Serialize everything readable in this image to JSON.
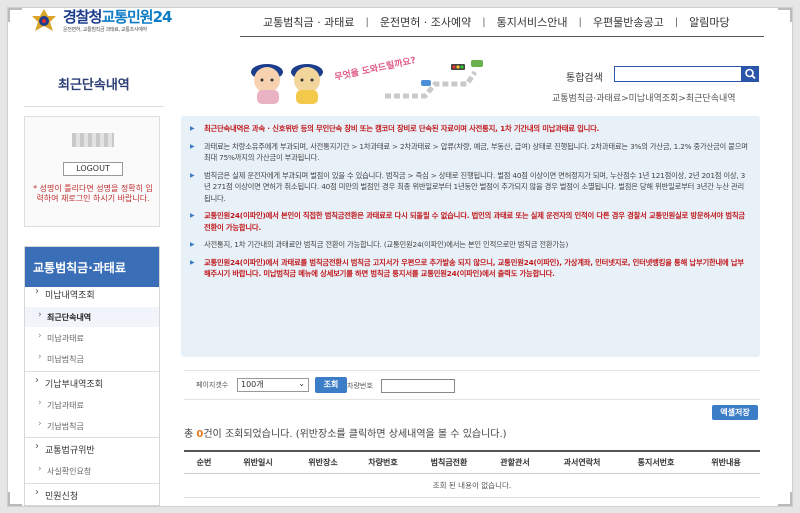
{
  "header": {
    "logo_police": "경찰청",
    "logo_service": "교통민원24",
    "logo_sub": "운전면허, 교통범칙금 과태료, 교통조사예약",
    "nav": [
      "교통범칙금 · 과태료",
      "운전면허 · 조사예약",
      "통지서비스안내",
      "우편물반송공고",
      "알림마당"
    ]
  },
  "page": {
    "title": "최근단속내역",
    "illustration_text": "무엇을 도와드릴까요?",
    "search_label": "통합검색",
    "search_placeholder": "",
    "breadcrumb": "교통범칙금·과태료>미납내역조회>최근단속내역"
  },
  "login": {
    "logout_label": "LOGOUT",
    "note": "* 성명이 틀리다면 성명을 정확히 입력하여 재로그인 하시기 바랍니다."
  },
  "sidebar": {
    "header": "교통범칙금·과태료",
    "items": [
      {
        "label": "미납내역조회",
        "type": "section"
      },
      {
        "label": "최근단속내역",
        "type": "sub",
        "active": true
      },
      {
        "label": "미납과태료",
        "type": "sub"
      },
      {
        "label": "미납범칙금",
        "type": "sub"
      },
      {
        "label": "기납부내역조회",
        "type": "section"
      },
      {
        "label": "기납과태료",
        "type": "sub"
      },
      {
        "label": "기납범칙금",
        "type": "sub"
      },
      {
        "label": "교통법규위반",
        "type": "section"
      },
      {
        "label": "사실확인요청",
        "type": "sub"
      },
      {
        "label": "민원신청",
        "type": "section"
      }
    ]
  },
  "info": [
    {
      "text": "최근단속내역은 과속 · 신호위반 등의 무인단속 장비 또는 캠코더 장비로 단속된 자료이며 사전통지, 1차 기간내의 미납과태료 입니다.",
      "red": true
    },
    {
      "text": "과태료는 차량소유주에게 부과되며, 사전통지기간 > 1차과태료 > 2차과태료 > 압류(차량, 예금, 부동산, 급여) 상태로 진행됩니다. 2차과태료는 3%의 가산금, 1.2% 중가산금이 붙으며 최대 75%까지의 가산금이 부과됩니다.",
      "red": false
    },
    {
      "text": "범칙금은 실제 운전자에게 부과되며 벌점이 있을 수 있습니다. 범칙금 > 즉심 > 상태로 진행됩니다. 벌점 40점 이상이면 면허정지가 되며, 누산점수 1년 121점이상, 2년 201점 이상, 3년 271점 이상이면 면허가 취소됩니다. 40점 미만의 벌점인 경우 최종 위반일로부터 1년동안 벌점이 추가되지 않을 경우 벌점이 소멸됩니다. 벌점은 당해 위반일로부터 3년간 누산 관리됩니다.",
      "red": false
    },
    {
      "text": "교통민원24(이파인)에서 본인이 직접한 범칙금전환은 과태료로 다시 되돌릴 수 없습니다. 법인의 과태료 또는 실제 운전자의 인적이 다른 경우 경찰서 교통민원실로 방문하셔야 범칙금 전환이 가능합니다.",
      "red": true
    },
    {
      "text": "사전통지, 1차 기간내의 과태료만 범칙금 전환이 가능합니다. (교통민원24(이파인)에서는 본인 인적으로만 범칙금 전환가능)",
      "red": false
    },
    {
      "text": "교통민원24(이파인)에서 과태료를 범칙금전환시 범칙금 고지서가 우편으로 추가발송 되지 않으니, 교통민원24(이파인), 가상계좌, 인터넷지로, 인터넷뱅킹을 통해 납부기한내에 납부해주시기 바랍니다. 미납범칙금 메뉴에 상세보기를 하면 범칙금 통지서를 교통민원24(이파인)에서 출력도 가능합니다.",
      "red": true
    }
  ],
  "filter": {
    "page_count_label": "페이지갯수",
    "page_count_value": "100개",
    "query_label": "조회",
    "vehicle_label": "차량번호"
  },
  "excel_label": "엑셀저장",
  "result": {
    "prefix": "총 ",
    "count": "0",
    "suffix": "건이 조회되었습니다. (위반장소를 클릭하면 상세내역을 볼 수 있습니다.)"
  },
  "table": {
    "columns": [
      "순번",
      "위반일시",
      "위반장소",
      "차량번호",
      "범칙금전환",
      "관할관서",
      "과서연락처",
      "통지서번호",
      "위반내용"
    ],
    "empty_message": "조회 된 내용이 없습니다."
  },
  "colors": {
    "brand_blue": "#1c3c8c",
    "accent_blue": "#3c7dc8",
    "warning_red": "#c0181c",
    "panel_bg": "#e8f1f7"
  }
}
